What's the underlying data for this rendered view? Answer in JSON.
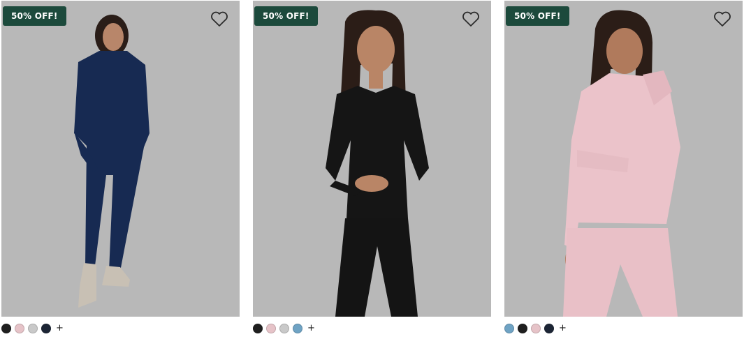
{
  "colors": {
    "badge_bg": "#1c4a3c",
    "image_bg": "#b8b8b8",
    "swatch_black": "#1f1f1f",
    "swatch_pink": "#e6c3c8",
    "swatch_gray": "#c9c9c9",
    "swatch_navy": "#1c2535",
    "swatch_blue": "#6fa3c4"
  },
  "products": [
    {
      "badge": "50% OFF!",
      "image": "model-navy-hoodie-joggers",
      "favorite_icon": "heart-outline-icon",
      "swatches": [
        "#1f1f1f",
        "#e6c3c8",
        "#c9c9c9",
        "#1c2535"
      ],
      "more_label": "+"
    },
    {
      "badge": "50% OFF!",
      "image": "model-black-crewneck-sweatshirt",
      "favorite_icon": "heart-outline-icon",
      "swatches": [
        "#1f1f1f",
        "#e6c3c8",
        "#c9c9c9",
        "#6fa3c4"
      ],
      "more_label": "+"
    },
    {
      "badge": "50% OFF!",
      "image": "model-pink-hoodie-joggers",
      "favorite_icon": "heart-outline-icon",
      "swatches": [
        "#6fa3c4",
        "#1f1f1f",
        "#e6c3c8",
        "#1c2535"
      ],
      "more_label": "+"
    }
  ]
}
